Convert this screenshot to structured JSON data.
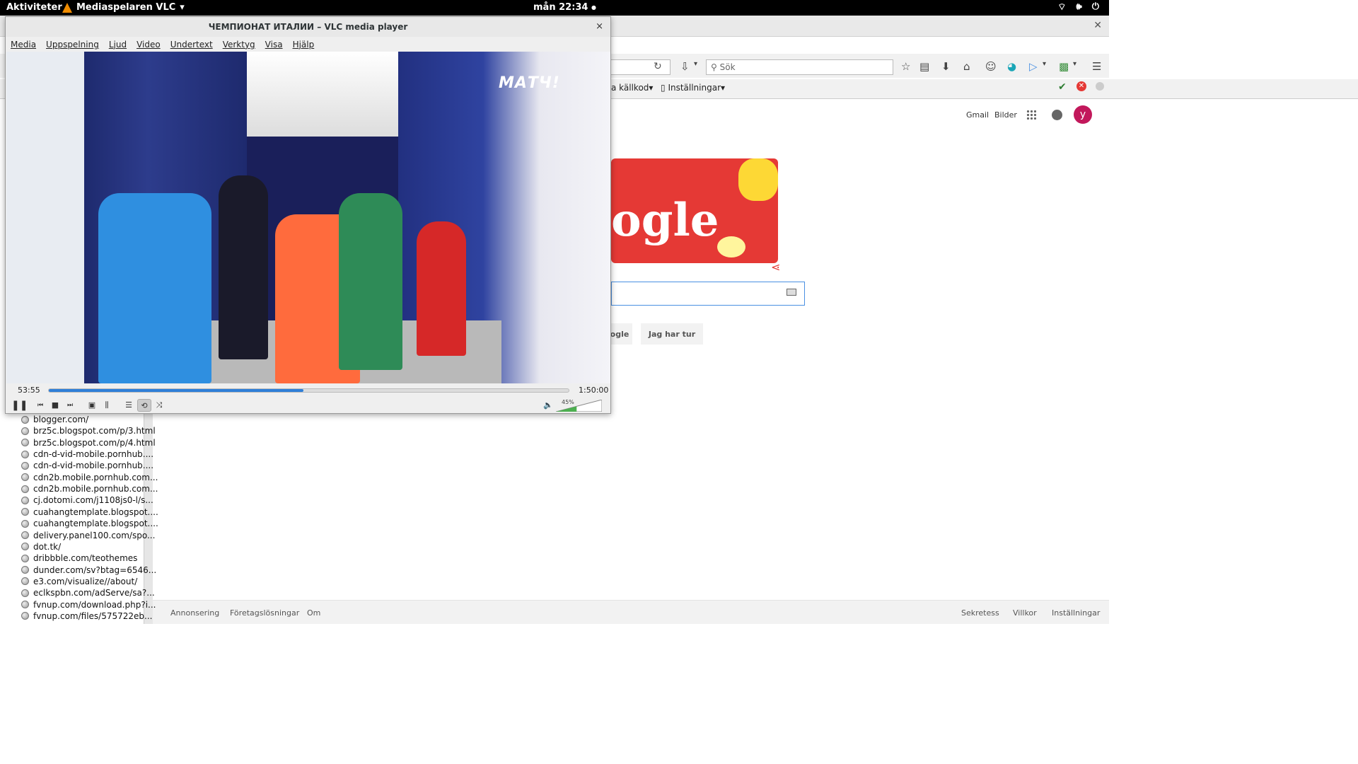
{
  "topbar": {
    "activities": "Aktiviteter",
    "app_name": "Mediaspelaren VLC",
    "app_arrow": "▾",
    "clock": "mån 22:34",
    "clock_dot": "●",
    "tray": [
      "wifi-icon",
      "volume-icon",
      "power-icon"
    ]
  },
  "firefox": {
    "search_placeholder": "Sök",
    "bookmarks": {
      "item1": "a källkod",
      "item2": "Inställningar"
    },
    "google": {
      "gmail": "Gmail",
      "images": "Bilder",
      "avatar_letter": "y",
      "doodle_text": "ogle",
      "btn_search": "ogle",
      "btn_lucky": "Jag har tur"
    },
    "footer": {
      "ads": "Annonsering",
      "business": "Företagslösningar",
      "about": "Om",
      "privacy": "Sekretess",
      "terms": "Villkor",
      "settings": "Inställningar"
    }
  },
  "history": [
    "blogger.com/",
    "brz5c.blogspot.com/p/3.html",
    "brz5c.blogspot.com/p/4.html",
    "cdn-d-vid-mobile.pornhub....",
    "cdn-d-vid-mobile.pornhub....",
    "cdn2b.mobile.pornhub.com...",
    "cdn2b.mobile.pornhub.com...",
    "cj.dotomi.com/j1108js0-l/s...",
    "cuahangtemplate.blogspot....",
    "cuahangtemplate.blogspot....",
    "delivery.panel100.com/spo...",
    "dot.tk/",
    "dribbble.com/teothemes",
    "dunder.com/sv?btag=6546...",
    "e3.com/visualize//about/",
    "eclkspbn.com/adServe/sa?...",
    "fvnup.com/download.php?i...",
    "fvnup.com/files/575722eb..."
  ],
  "vlc": {
    "title": "ЧЕМПИОНАТ ИТАЛИИ – VLC media player",
    "close": "×",
    "menu": [
      "Media",
      "Uppspelning",
      "Ljud",
      "Video",
      "Undertext",
      "Verktyg",
      "Visa",
      "Hjälp"
    ],
    "channel_logo": "МАТЧ!",
    "time_current": "53:55",
    "time_total": "1:50:00",
    "progress_fraction": 0.49,
    "volume_percent": "45%",
    "volume_level": 0.45,
    "accent_color": "#2f7fd8"
  }
}
